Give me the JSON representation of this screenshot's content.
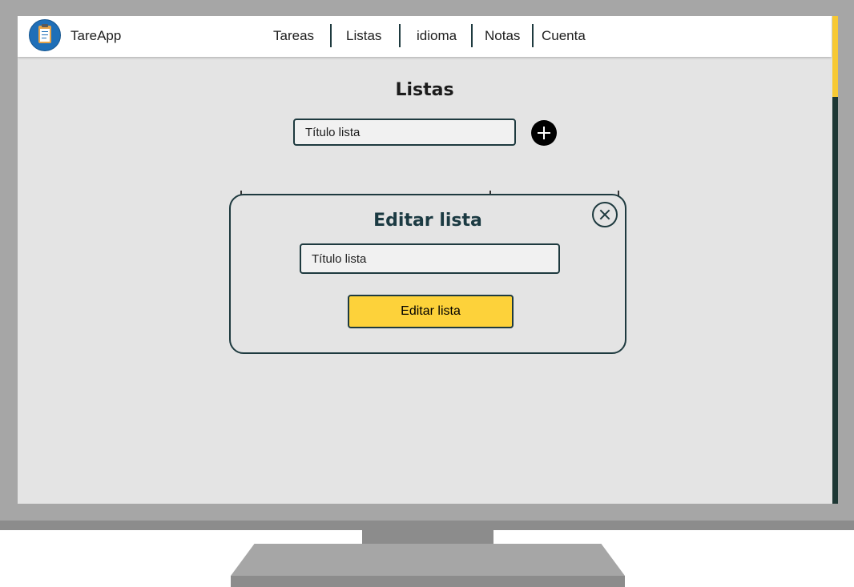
{
  "app": {
    "name": "TareApp"
  },
  "nav": {
    "items": [
      {
        "label": "Tareas"
      },
      {
        "label": "Listas"
      },
      {
        "label": "idioma"
      },
      {
        "label": "Notas"
      },
      {
        "label": "Cuenta"
      }
    ]
  },
  "main": {
    "title": "Listas",
    "new_list_input": {
      "placeholder": "Título lista",
      "value": ""
    },
    "add_icon": "plus-circle-icon"
  },
  "modal": {
    "title": "Editar lista",
    "input": {
      "placeholder": "Título lista",
      "value": ""
    },
    "submit_label": "Editar lista",
    "close_icon": "close-circle-icon"
  },
  "colors": {
    "accent_yellow": "#fdd23a",
    "dark_teal": "#1e3a3f",
    "screen_bg": "#e4e4e4",
    "scrollbar_track": "#1d3734",
    "scrollbar_thumb": "#f7c934"
  }
}
